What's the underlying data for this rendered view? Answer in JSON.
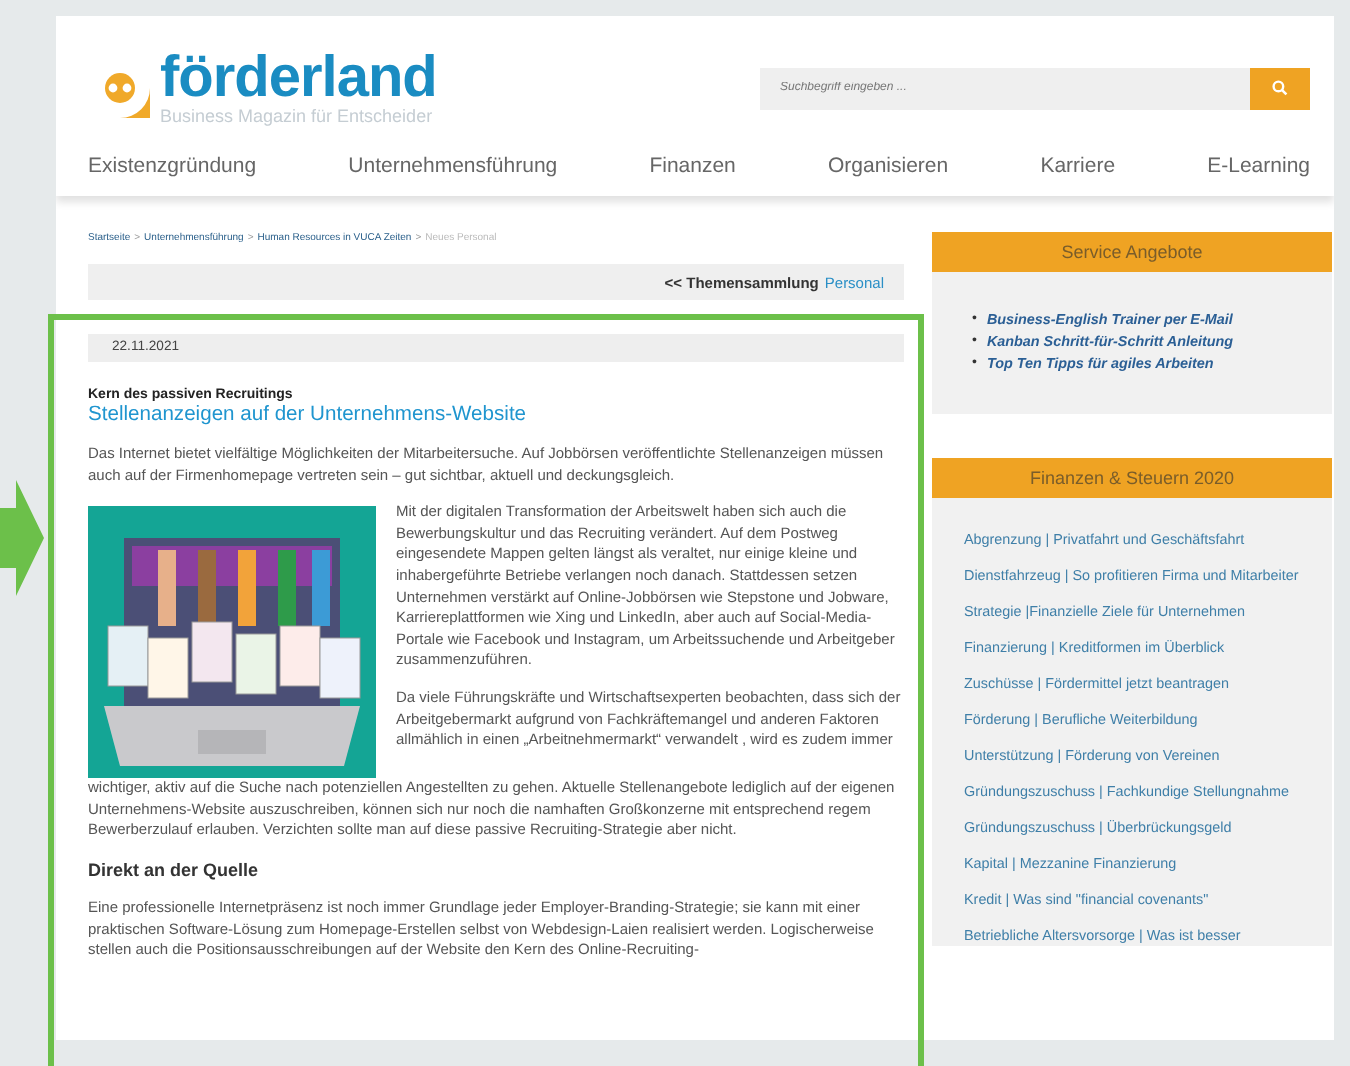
{
  "logo": {
    "name": "förderland",
    "tagline": "Business Magazin für Entscheider"
  },
  "search": {
    "placeholder": "Suchbegriff eingeben ..."
  },
  "nav": [
    "Existenzgründung",
    "Unternehmensführung",
    "Finanzen",
    "Organisieren",
    "Karriere",
    "E-Learning"
  ],
  "breadcrumb": {
    "separator": ">",
    "items": [
      {
        "label": "Startseite",
        "current": false
      },
      {
        "label": "Unternehmensführung",
        "current": false
      },
      {
        "label": "Human Resources in VUCA Zeiten",
        "current": false
      },
      {
        "label": "Neues Personal",
        "current": true
      }
    ]
  },
  "theme_bar": {
    "prefix": "<< Themensammlung",
    "link": "Personal"
  },
  "article": {
    "date": "22.11.2021",
    "kicker": "Kern des passiven Recruitings",
    "title": "Stellenanzeigen auf der Unternehmens-Website",
    "intro": "Das Internet bietet vielfältige Möglichkeiten der Mitarbeitersuche. Auf Jobbörsen veröffentlichte Stellenanzeigen müssen auch auf der Firmenhomepage vertreten sein – gut sichtbar, aktuell und deckungsgleich.",
    "image": {
      "kind": "picture"
    },
    "paragraphs": [
      "Mit der digitalen Transformation der Arbeitswelt haben sich auch die Bewerbungskultur und das Recruiting verändert. Auf dem Postweg eingesendete Mappen gelten längst als veraltet, nur einige kleine und inhabergeführte Betriebe verlangen noch danach. Stattdessen setzen Unternehmen verstärkt auf Online-Jobbörsen wie Stepstone und Jobware, Karriereplattformen wie Xing und LinkedIn, aber auch auf Social-Media-Portale wie Facebook und Instagram, um Arbeitssuchende und Arbeitgeber zusammenzuführen.",
      "Da viele Führungskräfte und Wirtschaftsexperten beobachten, dass sich der Arbeitgebermarkt aufgrund von Fachkräftemangel und anderen Faktoren allmählich in einen „Arbeitnehmermarkt“ verwandelt , wird es zudem immer",
      "wichtiger, aktiv auf die Suche nach potenziellen Angestellten zu gehen. Aktuelle Stellenangebote lediglich auf der eigenen Unternehmens-Website auszuschreiben, können sich nur noch die namhaften Großkonzerne mit entsprechend regem Bewerberzulauf erlauben. Verzichten sollte man auf diese passive Recruiting-Strategie aber nicht."
    ],
    "subheading": "Direkt an der Quelle",
    "closing": "Eine professionelle Internetpräsenz ist noch immer Grundlage jeder Employer-Branding-Strategie; sie kann mit einer praktischen Software-Lösung zum Homepage-Erstellen selbst von Webdesign-Laien realisiert werden. Logischerweise stellen auch die Positionsausschreibungen auf der Website den Kern des Online-Recruiting-"
  },
  "sidebar": [
    {
      "title": "Service Angebote",
      "kind": "bullets",
      "marker": "•",
      "items": [
        "Business-English Trainer per E-Mail",
        "Kanban Schritt-für-Schritt Anleitung",
        "Top Ten Tipps für agiles Arbeiten"
      ]
    },
    {
      "title": "Finanzen & Steuern 2020",
      "kind": "links",
      "items": [
        "Abgrenzung | Privatfahrt und Geschäftsfahrt",
        "Dienstfahrzeug | So profitieren Firma und Mitarbeiter",
        "Strategie |Finanzielle Ziele für Unternehmen",
        "Finanzierung | Kreditformen im Überblick",
        "Zuschüsse | Fördermittel jetzt beantragen",
        "Förderung | Berufliche Weiterbildung",
        "Unterstützung | Förderung von Vereinen",
        "Gründungszuschuss | Fachkundige Stellungnahme",
        "Gründungszuschuss | Überbrückungsgeld",
        "Kapital | Mezzanine Finanzierung",
        "Kredit | Was sind \"financial covenants\"",
        "Betriebliche Altersvorsorge | Was ist besser"
      ]
    }
  ]
}
